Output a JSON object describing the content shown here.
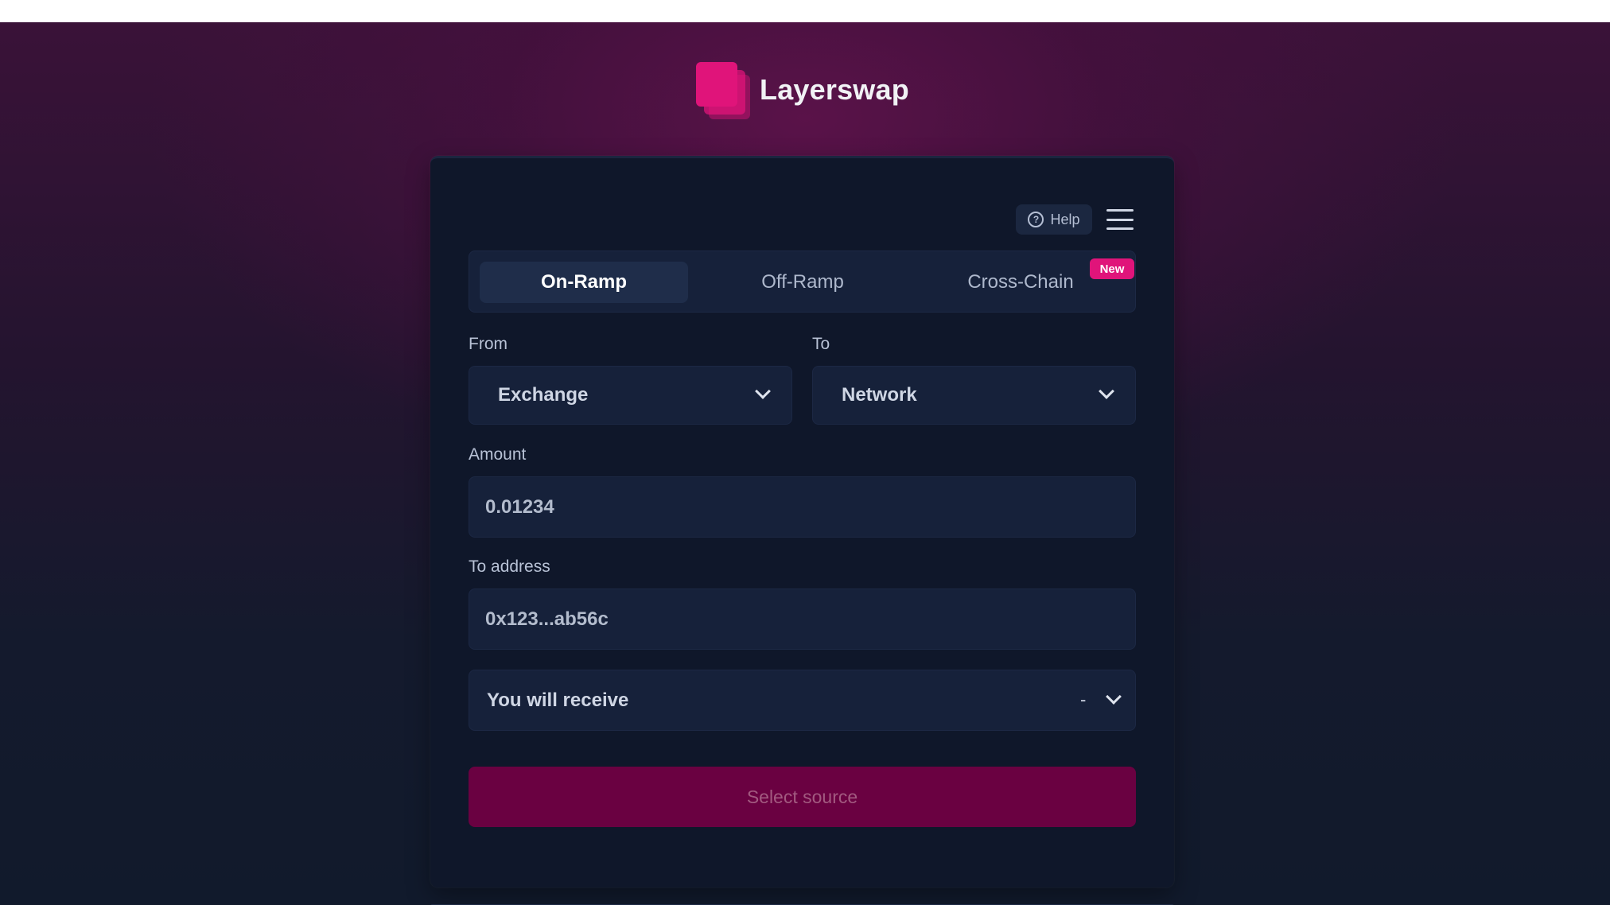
{
  "app": {
    "name": "Layerswap",
    "accent_color": "#e0147a"
  },
  "toolbar": {
    "help_label": "Help",
    "help_icon": "question-circle-icon",
    "menu_icon": "hamburger-menu-icon"
  },
  "tabs": [
    {
      "label": "On-Ramp",
      "active": true
    },
    {
      "label": "Off-Ramp",
      "active": false
    },
    {
      "label": "Cross-Chain",
      "active": false,
      "badge": "New"
    }
  ],
  "form": {
    "from": {
      "label": "From",
      "value": "Exchange"
    },
    "to": {
      "label": "To",
      "value": "Network"
    },
    "amount": {
      "label": "Amount",
      "placeholder": "0.01234"
    },
    "address": {
      "label": "To address",
      "placeholder": "0x123...ab56c"
    },
    "receive": {
      "label": "You will receive",
      "value": "-"
    },
    "submit_label": "Select source"
  }
}
